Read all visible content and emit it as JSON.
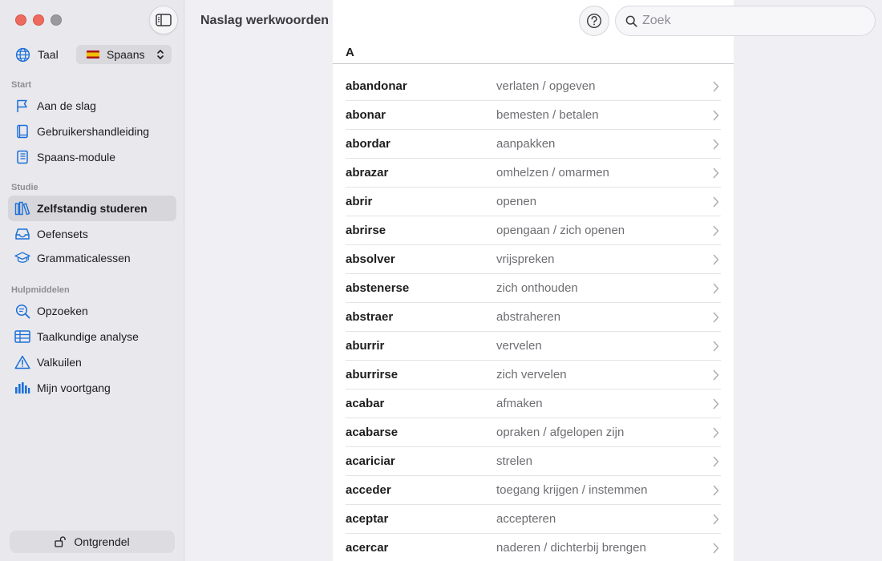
{
  "sidebar": {
    "language_label": "Taal",
    "language_value": "Spaans",
    "sections": {
      "start": "Start",
      "study": "Studie",
      "tools": "Hulpmiddelen"
    },
    "start_items": [
      {
        "label": "Aan de slag",
        "icon": "flag-icon"
      },
      {
        "label": "Gebruikershandleiding",
        "icon": "book-icon"
      },
      {
        "label": "Spaans-module",
        "icon": "book-closed-icon"
      }
    ],
    "study_items": [
      {
        "label": "Zelfstandig studeren",
        "icon": "books-icon",
        "active": true
      },
      {
        "label": "Oefensets",
        "icon": "tray-icon"
      },
      {
        "label": "Grammaticalessen",
        "icon": "graduation-cap-icon"
      }
    ],
    "tools_items": [
      {
        "label": "Opzoeken",
        "icon": "magnifier-text-icon"
      },
      {
        "label": "Taalkundige analyse",
        "icon": "table-icon"
      },
      {
        "label": "Valkuilen",
        "icon": "warning-icon"
      },
      {
        "label": "Mijn voortgang",
        "icon": "bar-chart-icon"
      }
    ],
    "unlock_label": "Ontgrendel"
  },
  "header": {
    "title": "Naslag werkwoorden"
  },
  "search": {
    "placeholder": "Zoek",
    "value": ""
  },
  "list": {
    "letter": "A",
    "rows": [
      {
        "verb": "abandonar",
        "translation": "verlaten / opgeven"
      },
      {
        "verb": "abonar",
        "translation": "bemesten / betalen"
      },
      {
        "verb": "abordar",
        "translation": "aanpakken"
      },
      {
        "verb": "abrazar",
        "translation": "omhelzen / omarmen"
      },
      {
        "verb": "abrir",
        "translation": "openen"
      },
      {
        "verb": "abrirse",
        "translation": "opengaan / zich openen"
      },
      {
        "verb": "absolver",
        "translation": "vrijspreken"
      },
      {
        "verb": "abstenerse",
        "translation": "zich onthouden"
      },
      {
        "verb": "abstraer",
        "translation": "abstraheren"
      },
      {
        "verb": "aburrir",
        "translation": "vervelen"
      },
      {
        "verb": "aburrirse",
        "translation": "zich vervelen"
      },
      {
        "verb": "acabar",
        "translation": "afmaken"
      },
      {
        "verb": "acabarse",
        "translation": "opraken / afgelopen zijn"
      },
      {
        "verb": "acariciar",
        "translation": "strelen"
      },
      {
        "verb": "acceder",
        "translation": "toegang krijgen / instemmen"
      },
      {
        "verb": "aceptar",
        "translation": "accepteren"
      },
      {
        "verb": "acercar",
        "translation": "naderen / dichterbij brengen"
      }
    ]
  },
  "colors": {
    "accent": "#1a6fd8",
    "sidebar_bg": "#e8e8ed",
    "active_bg": "#d6d6db"
  }
}
